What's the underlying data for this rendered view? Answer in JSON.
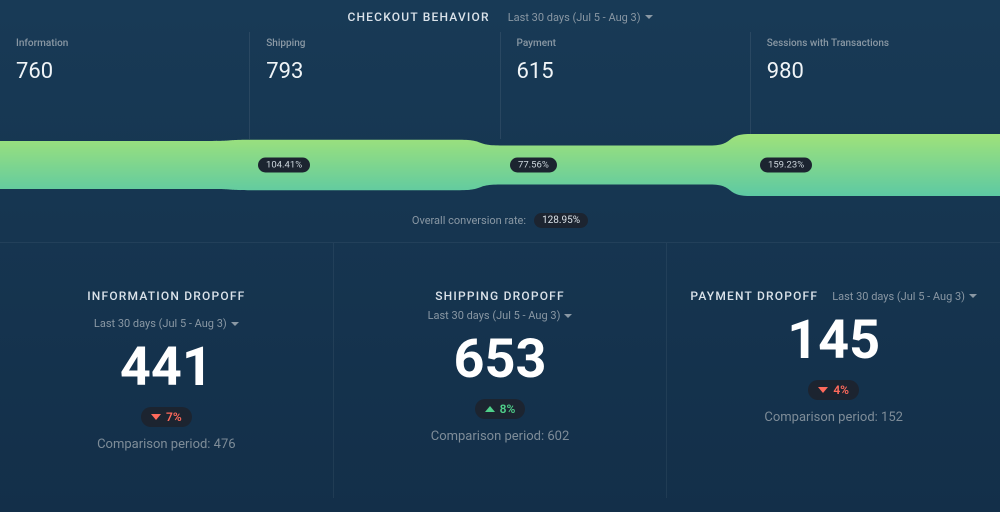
{
  "top": {
    "title": "CHECKOUT BEHAVIOR",
    "period_label": "Last 30 days (Jul 5 - Aug 3)",
    "stages": [
      {
        "label": "Information",
        "value": "760"
      },
      {
        "label": "Shipping",
        "value": "793"
      },
      {
        "label": "Payment",
        "value": "615"
      },
      {
        "label": "Sessions with Transactions",
        "value": "980"
      }
    ],
    "transition_badges": [
      "104.41%",
      "77.56%",
      "159.23%"
    ],
    "overall_label": "Overall conversion rate:",
    "overall_value": "128.95%"
  },
  "cards": [
    {
      "title": "INFORMATION DROPOFF",
      "period": "Last 30 days (Jul 5 - Aug 3)",
      "value": "441",
      "delta_dir": "down",
      "delta_pct": "7%",
      "comparison": "Comparison period: 476"
    },
    {
      "title": "SHIPPING DROPOFF",
      "period": "Last 30 days (Jul 5 - Aug 3)",
      "value": "653",
      "delta_dir": "up",
      "delta_pct": "8%",
      "comparison": "Comparison period: 602"
    },
    {
      "title": "PAYMENT DROPOFF",
      "period": "Last 30 days (Jul 5 - Aug 3)",
      "value": "145",
      "delta_dir": "down",
      "delta_pct": "4%",
      "comparison": "Comparison period: 152"
    }
  ],
  "chart_data": {
    "type": "bar",
    "title": "Checkout Behavior Funnel",
    "categories": [
      "Information",
      "Shipping",
      "Payment",
      "Sessions with Transactions"
    ],
    "values": [
      760,
      793,
      615,
      980
    ],
    "transition_rates_pct": [
      104.41,
      77.56,
      159.23
    ],
    "overall_conversion_pct": 128.95,
    "dropoff": {
      "categories": [
        "Information Dropoff",
        "Shipping Dropoff",
        "Payment Dropoff"
      ],
      "current": [
        441,
        653,
        145
      ],
      "previous": [
        476,
        602,
        152
      ],
      "delta_pct": [
        -7,
        8,
        -4
      ]
    }
  }
}
